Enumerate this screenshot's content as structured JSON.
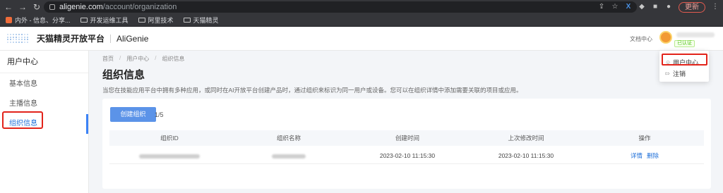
{
  "browser": {
    "url_domain": "aligenie.com",
    "url_path": "/account/organization",
    "update_label": "更新",
    "bookmarks": [
      {
        "label": "内外 - 信息、分享..."
      },
      {
        "label": "开发运维工具"
      },
      {
        "label": "阿里技术"
      },
      {
        "label": "天猫精灵"
      }
    ]
  },
  "header": {
    "title": "天猫精灵开放平台",
    "brand": "AliGenie",
    "doc_center": "文档中心",
    "verified_badge": "已认证"
  },
  "dropdown": {
    "items": [
      {
        "label": "用户中心",
        "icon": "user-icon"
      },
      {
        "label": "注销",
        "icon": "logout-icon"
      }
    ]
  },
  "sidebar": {
    "heading": "用户中心",
    "items": [
      {
        "label": "基本信息"
      },
      {
        "label": "主播信息"
      },
      {
        "label": "组织信息",
        "active": true
      }
    ]
  },
  "breadcrumb": [
    "首页",
    "用户中心",
    "组织信息"
  ],
  "page": {
    "title": "组织信息",
    "description": "当您在技能应用平台中拥有多种应用，或同时在AI开放平台创建产品时，通过组织来标识为同一用户或设备。您可以在组织详情中添加需要关联的项目或应用。",
    "create_button": "创建组织",
    "quota": "1/5"
  },
  "table": {
    "columns": [
      "组织ID",
      "组织名称",
      "创建时间",
      "上次修改时间",
      "操作"
    ],
    "rows": [
      {
        "created": "2023-02-10 11:15:30",
        "modified": "2023-02-10 11:15:30",
        "actions": [
          "详情",
          "删除"
        ]
      }
    ]
  },
  "colors": {
    "accent": "#1e6fd9",
    "button": "#5b93e8",
    "highlight": "#e2231a"
  }
}
